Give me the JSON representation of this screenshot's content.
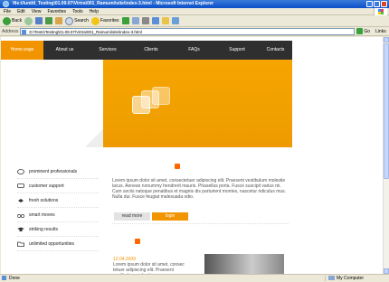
{
  "window": {
    "title": "file:///untitl_Testing\\01.09.07\\Virtra\\001_Ramumi\\site\\index-3.html - Microsoft Internet Explorer"
  },
  "menu": [
    "File",
    "Edit",
    "View",
    "Favorites",
    "Tools",
    "Help"
  ],
  "toolbar": {
    "back_label": "Back",
    "search_label": "Search",
    "favorites_label": "Favorites"
  },
  "address": {
    "label": "Address",
    "url": "D:\\Tests\\Testing\\01.09.07\\Virtra\\001_Ramumi\\site\\index-3.html",
    "go_label": "Go",
    "links_label": "Links"
  },
  "site": {
    "nav": [
      "Home page",
      "About us",
      "Services",
      "Clients",
      "FAQs",
      "Support",
      "Contacts"
    ],
    "sidebar": [
      {
        "label": "prominent professionals",
        "icon": "speech-bubble-icon"
      },
      {
        "label": "customer support",
        "icon": "chat-icon"
      },
      {
        "label": "fresh solutions",
        "icon": "refresh-arrows-icon"
      },
      {
        "label": "smart moves",
        "icon": "bicycle-icon"
      },
      {
        "label": "striking results",
        "icon": "graduation-cap-icon"
      },
      {
        "label": "unlimited opportunities",
        "icon": "folder-icon"
      }
    ],
    "intro": "Lorem ipsum dolor sit amet, consectetuer adipiscing elit. Praesent vestibulum molestie lacus. Aenean nonummy hendrerit mauris. Phasellus porta. Fusce suscipit varius mi. Cum sociis natoque penatibus et magnis dis parturient montes, nascetur ridiculus mus. Nulla dui. Fusce feugiat malesuada odio.",
    "read_more_label": "read more",
    "login_label": "login",
    "news_date": "12.04.2009",
    "news_text": "Lorem ipsum dolor sit amet, consec tetuer adipiscing elit. Praesent vestibulum molestie"
  },
  "status": {
    "left": "Done",
    "right": "My Computer"
  }
}
